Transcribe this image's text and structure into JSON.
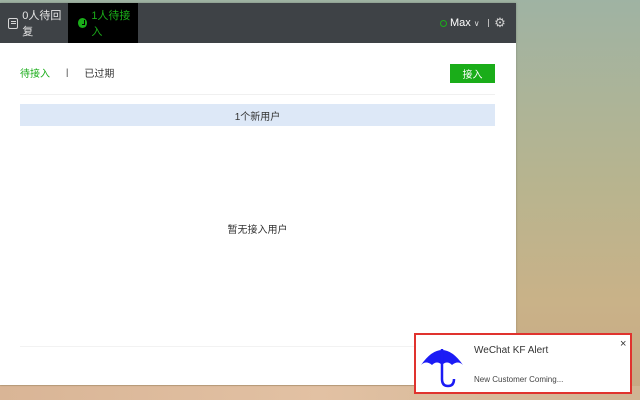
{
  "topbar": {
    "reply_tab_label": "0人待回复",
    "waiting_tab_label": "1人待接入",
    "user_name": "Max",
    "chevron": "∨",
    "settings_icon": "gear-icon"
  },
  "subtabs": {
    "pending_label": "待接入",
    "separator": "|",
    "expired_label": "已过期"
  },
  "toolbar": {
    "accept_label": "接入"
  },
  "main": {
    "new_user_banner": "1个新用户",
    "empty_message": "暂无接入用户"
  },
  "notification": {
    "title": "WeChat KF Alert",
    "body": "New Customer Coming...",
    "close_label": "×",
    "icon": "umbrella-icon"
  },
  "colors": {
    "accent_green": "#1aad19",
    "topbar_bg": "#3e4246",
    "banner_bg": "#dde8f7",
    "alert_border": "#e0332e",
    "umbrella_blue": "#1b1bf5"
  }
}
